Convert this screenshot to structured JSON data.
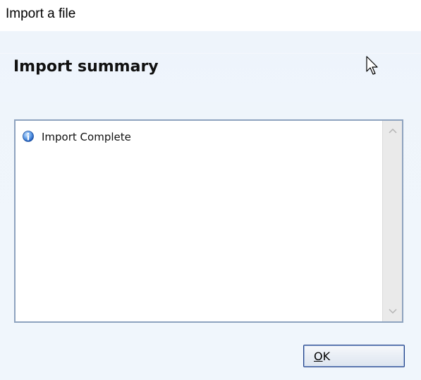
{
  "window": {
    "title": "Import a file"
  },
  "dialog": {
    "heading": "Import summary",
    "log": {
      "items": [
        {
          "icon": "info-icon",
          "text": "Import Complete"
        }
      ]
    },
    "buttons": {
      "ok_mnemonic": "O",
      "ok_rest": "K"
    }
  },
  "colors": {
    "dialog_background": "#eff5fb",
    "log_border": "#8ea3bf",
    "ok_border": "#1f3f87"
  }
}
